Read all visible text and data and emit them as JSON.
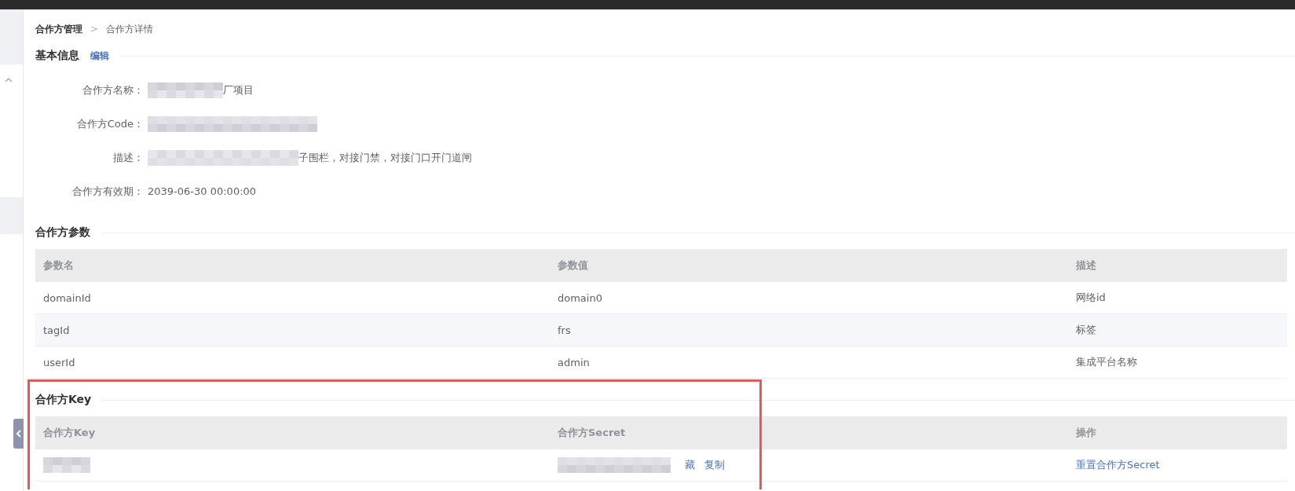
{
  "breadcrumb": {
    "items": [
      {
        "label": "合作方管理",
        "current": false
      },
      {
        "label": "合作方详情",
        "current": true
      }
    ],
    "separator": ">"
  },
  "basic_info": {
    "title": "基本信息",
    "edit_link": "编辑",
    "fields": [
      {
        "label": "合作方名称：",
        "value": "厂项目",
        "redacted": true
      },
      {
        "label": "合作方Code：",
        "redacted": true
      },
      {
        "label": "描述：",
        "value": "子围栏，对接门禁，对接门口开门道闸",
        "redacted": true
      },
      {
        "label": "合作方有效期：",
        "value": "2039-06-30 00:00:00",
        "redacted": false
      }
    ]
  },
  "params": {
    "title": "合作方参数",
    "highlighted": false,
    "columns": [
      "参数名",
      "参数值",
      "描述"
    ],
    "rows": [
      {
        "cells": [
          {
            "text": "domainId"
          },
          {
            "text": "domain0"
          },
          {
            "text": "网络id"
          }
        ]
      },
      {
        "cells": [
          {
            "text": "tagId"
          },
          {
            "text": "frs"
          },
          {
            "text": "标签"
          }
        ]
      },
      {
        "cells": [
          {
            "text": "userId"
          },
          {
            "text": "admin"
          },
          {
            "text": "集成平台名称"
          }
        ]
      }
    ]
  },
  "keys": {
    "title": "合作方Key",
    "highlighted": true,
    "columns": [
      "合作方Key",
      "合作方Secret",
      "操作"
    ],
    "rows": [
      {
        "cells": [
          {
            "redacted": true
          },
          {
            "redacted": true,
            "links": [
              "藏",
              "复制"
            ]
          },
          {
            "links": [
              "重置合作方Secret"
            ]
          }
        ]
      }
    ]
  }
}
